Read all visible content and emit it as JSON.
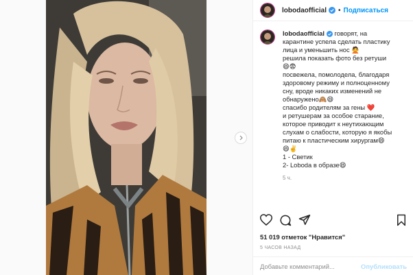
{
  "header": {
    "username": "lobodaofficial",
    "dot": "•",
    "follow_label": "Подписаться"
  },
  "caption": {
    "username": "lobodaofficial",
    "lines": [
      " говорят, на",
      "карантине успела сделать пластику",
      "лица и уменьшить нос 🙅",
      "решила показать фото без ретуши",
      "😄😨",
      "посвежела, помолодела, благодаря",
      "здоровому режиму и полноценному",
      "сну, вроде никаких изменений не",
      "обнаружено🙈😄",
      "спасибо родителям за гены ❤️",
      " и ретушерам за особое старание,",
      "которое приводит к неутихающим",
      "слухам о слабости, которую я якобы",
      "питаю к пластическим хирургам😄",
      "😄✌️",
      "1 - Светик",
      "2- Loboda в образе😄"
    ],
    "time": "5 ч."
  },
  "icons": {
    "like": "heart-icon",
    "comment": "comment-icon",
    "share": "share-icon",
    "save": "bookmark-icon",
    "next": "chevron-right-icon",
    "verified": "verified-badge-icon"
  },
  "likes": "51 019 отметок \"Нравится\"",
  "posted_ago": "5 ЧАСОВ НАЗАД",
  "comment_box": {
    "placeholder": "Добавьте комментарий...",
    "publish_label": "Опубликовать"
  },
  "colors": {
    "accent": "#0095f6",
    "verified": "#3897f0",
    "publish_disabled": "#b2dffc",
    "muted": "#8e8e8e"
  }
}
